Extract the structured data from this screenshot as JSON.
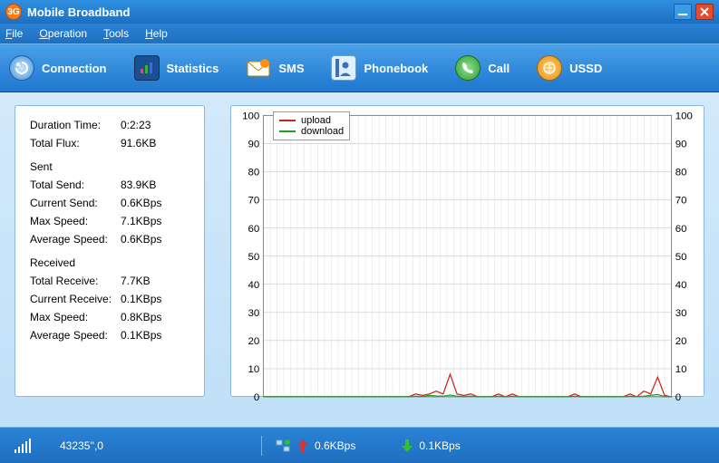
{
  "window": {
    "title": "Mobile Broadband"
  },
  "menu": {
    "file": "File",
    "operation": "Operation",
    "tools": "Tools",
    "help": "Help"
  },
  "toolbar": {
    "connection": "Connection",
    "statistics": "Statistics",
    "sms": "SMS",
    "phonebook": "Phonebook",
    "call": "Call",
    "ussd": "USSD"
  },
  "stats": {
    "duration_label": "Duration Time:",
    "duration_value": "0:2:23",
    "totalflux_label": "Total Flux:",
    "totalflux_value": "91.6KB",
    "sent_header": "Sent",
    "total_send_label": "Total Send:",
    "total_send_value": "83.9KB",
    "current_send_label": "Current Send:",
    "current_send_value": "0.6KBps",
    "max_speed_up_label": "Max Speed:",
    "max_speed_up_value": "7.1KBps",
    "avg_speed_up_label": "Average Speed:",
    "avg_speed_up_value": "0.6KBps",
    "received_header": "Received",
    "total_recv_label": "Total Receive:",
    "total_recv_value": "7.7KB",
    "current_recv_label": "Current Receive:",
    "current_recv_value": "0.1KBps",
    "max_speed_dn_label": "Max Speed:",
    "max_speed_dn_value": "0.8KBps",
    "avg_speed_dn_label": "Average Speed:",
    "avg_speed_dn_value": "0.1KBps"
  },
  "legend": {
    "upload": "upload",
    "download": "download"
  },
  "status": {
    "network": "43235'',0",
    "up_rate": "0.6KBps",
    "down_rate": "0.1KBps"
  },
  "colors": {
    "upload": "#d02020",
    "download": "#20a020"
  },
  "chart_data": {
    "type": "line",
    "ylabel": "",
    "xlabel": "",
    "ylim": [
      0,
      100
    ],
    "yticks": [
      0,
      10,
      20,
      30,
      40,
      50,
      60,
      70,
      80,
      90,
      100
    ],
    "xlim": [
      0,
      60
    ],
    "series": [
      {
        "name": "upload",
        "color": "#d02020",
        "values": [
          0,
          0,
          0,
          0,
          0,
          0,
          0,
          0,
          0,
          0,
          0,
          0,
          0,
          0,
          0,
          0,
          0,
          0,
          0,
          0,
          0,
          0,
          1,
          0.5,
          1,
          2,
          1,
          8,
          1,
          0.5,
          1,
          0,
          0,
          0,
          1,
          0,
          1,
          0,
          0,
          0,
          0,
          0,
          0,
          0,
          0,
          1,
          0,
          0,
          0,
          0,
          0,
          0,
          0,
          1,
          0,
          2,
          1,
          7,
          0.5,
          0
        ]
      },
      {
        "name": "download",
        "color": "#20a020",
        "values": [
          0,
          0,
          0,
          0,
          0,
          0,
          0,
          0,
          0,
          0,
          0,
          0,
          0,
          0,
          0,
          0,
          0,
          0,
          0,
          0,
          0,
          0,
          0.2,
          0.1,
          0.5,
          0.3,
          0.2,
          0.6,
          0.2,
          0.1,
          0.2,
          0,
          0,
          0,
          0.2,
          0,
          0.2,
          0,
          0,
          0,
          0,
          0,
          0,
          0,
          0,
          0.2,
          0,
          0,
          0,
          0,
          0,
          0,
          0,
          0.2,
          0,
          0.2,
          0.5,
          0.8,
          0.1,
          0
        ]
      }
    ]
  }
}
